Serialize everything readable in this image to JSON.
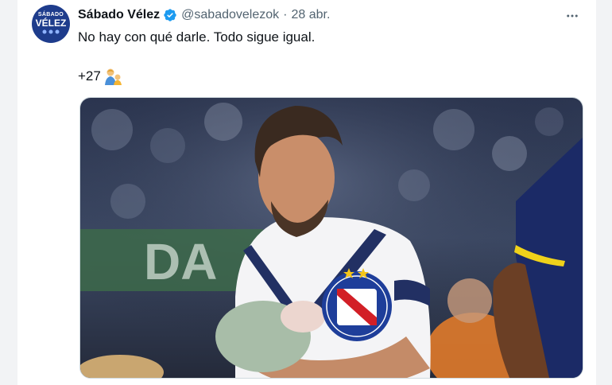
{
  "author": {
    "display_name": "Sábado Vélez",
    "handle": "@sabadovelezok",
    "separator": "·",
    "date": "28 abr.",
    "avatar_text_top": "SÁBADO",
    "avatar_text_main": "VÉLEZ"
  },
  "tweet": {
    "text_line1": "No hay con qué darle. Todo sigue igual.",
    "text_line2": "+27"
  },
  "media": {
    "banner_text": "DA"
  },
  "icons": {
    "verified": "verified-badge-icon",
    "more": "more-options-icon",
    "emoji": "father-child-emoji-icon"
  },
  "colors": {
    "verified": "#1d9bf0",
    "text": "#0f1419",
    "muted": "#536471"
  }
}
